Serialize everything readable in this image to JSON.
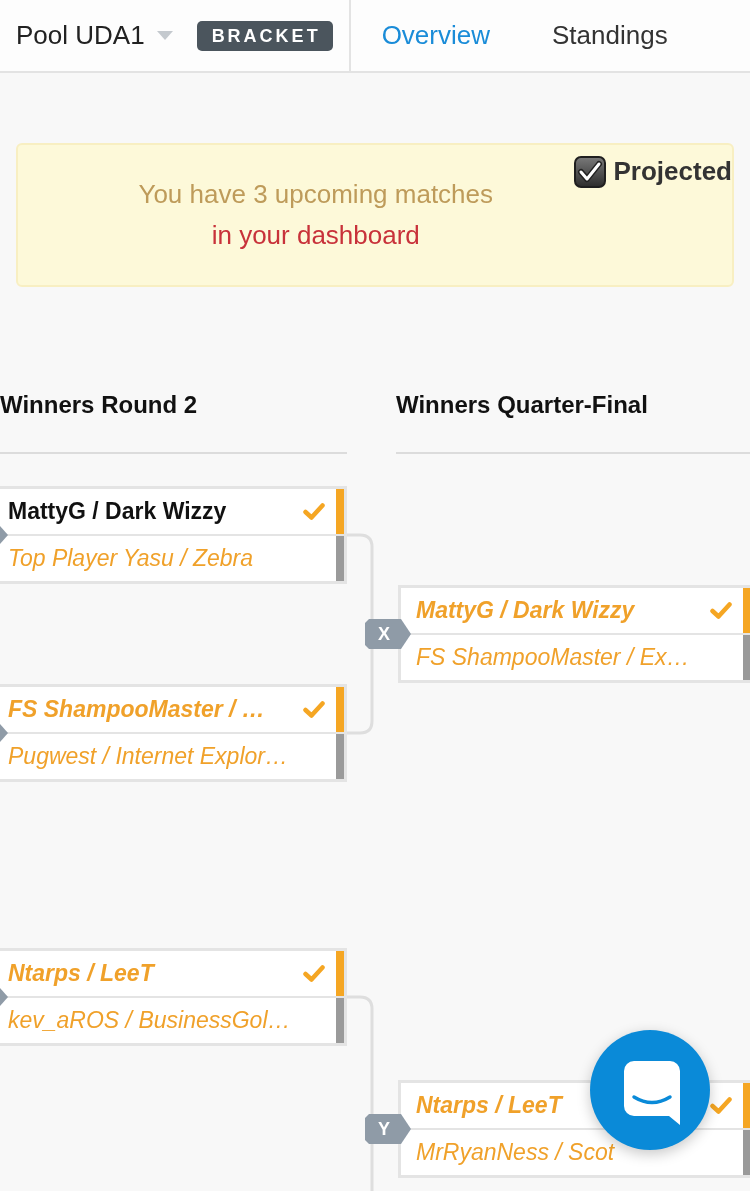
{
  "header": {
    "pool_selector": "Pool UDA1",
    "badge": "BRACKET",
    "tabs": [
      {
        "label": "Overview",
        "selected": true
      },
      {
        "label": "Standings",
        "selected": false
      }
    ]
  },
  "alert": {
    "message": "You have 3 upcoming matches",
    "link": "in your dashboard"
  },
  "projected": {
    "label": "Projected",
    "checked": true
  },
  "rounds": [
    {
      "title": "Winners Round 2",
      "matches": [
        {
          "players": [
            {
              "name": "MattyG / Dark Wizzy",
              "winner": true,
              "projected": false
            },
            {
              "name": "Top Player Yasu / Zebra",
              "winner": false,
              "projected": true
            }
          ]
        },
        {
          "players": [
            {
              "name": "FS ShampooMaster / …",
              "winner": true,
              "projected": true
            },
            {
              "name": "Pugwest / Internet Explor…",
              "winner": false,
              "projected": true
            }
          ]
        },
        {
          "players": [
            {
              "name": "Ntarps / LeeT",
              "winner": true,
              "projected": true
            },
            {
              "name": "kev_aROS / BusinessGol…",
              "winner": false,
              "projected": true
            }
          ]
        }
      ]
    },
    {
      "title": "Winners Quarter-Final",
      "matches": [
        {
          "tag": "X",
          "players": [
            {
              "name": "MattyG / Dark Wizzy",
              "winner": true,
              "projected": true
            },
            {
              "name": "FS ShampooMaster / Ex…",
              "winner": false,
              "projected": true
            }
          ]
        },
        {
          "tag": "Y",
          "players": [
            {
              "name": "Ntarps / LeeT",
              "winner": true,
              "projected": true
            },
            {
              "name": "MrRyanNess / Scot",
              "winner": false,
              "projected": true
            }
          ]
        }
      ]
    }
  ]
}
